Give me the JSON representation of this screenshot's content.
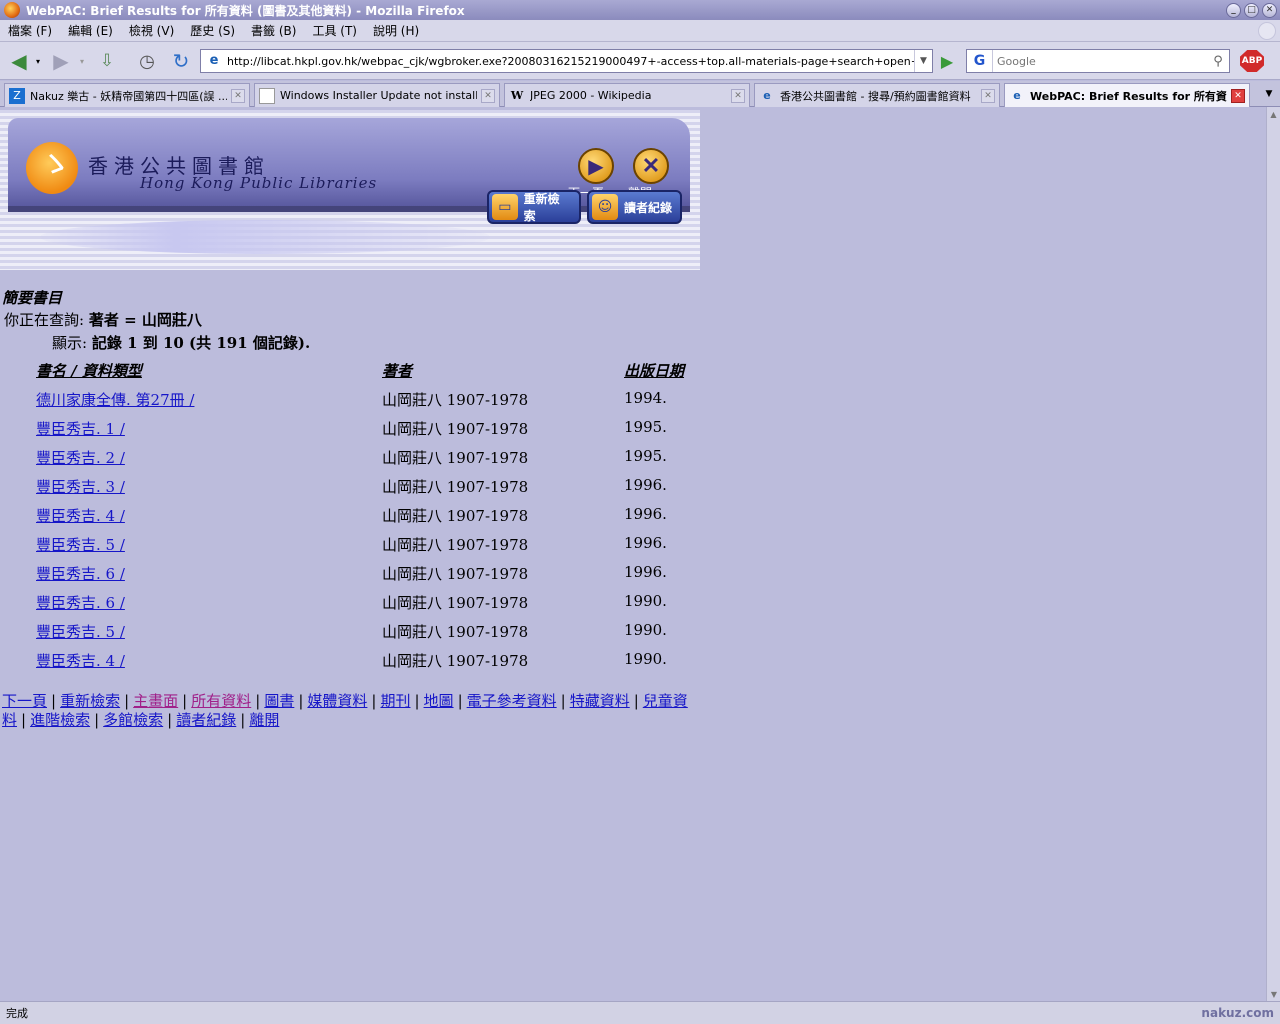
{
  "window": {
    "title": "WebPAC: Brief Results for 所有資料 (圖書及其他資料) - Mozilla Firefox"
  },
  "menu": {
    "items": [
      "檔案 (F)",
      "編輯 (E)",
      "檢視 (V)",
      "歷史 (S)",
      "書籤 (B)",
      "工具 (T)",
      "說明 (H)"
    ]
  },
  "toolbar": {
    "url": "http://libcat.hkpl.gov.hk/webpac_cjk/wgbroker.exe?20080316215219000497+-access+top.all-materials-page+search+open+A+山岡莊八%",
    "search_placeholder": "Google",
    "adblock_label": "ABP"
  },
  "tabs": [
    {
      "label": "Nakuz 樂古 - 妖精帝國第四十四區(誤 ..."
    },
    {
      "label": "Windows Installer Update not installed"
    },
    {
      "label": "JPEG 2000 - Wikipedia"
    },
    {
      "label": "香港公共圖書館 - 搜尋/預約圖書館資料"
    },
    {
      "label": "WebPAC: Brief Results for 所有資..."
    }
  ],
  "banner": {
    "name_zh": "香港公共圖書館",
    "name_en": "Hong Kong Public Libraries",
    "next_label": "下一頁",
    "exit_label": "離開",
    "research_label": "重新檢索",
    "reader_label": "讀者紀錄"
  },
  "page": {
    "title": "簡要書目",
    "query_prefix": "你正在查詢:",
    "query_value": "著者 = 山岡莊八",
    "count_prefix": "顯示:",
    "count_value": "記錄 1 到 10 (共 191 個記錄)."
  },
  "results": {
    "headers": [
      "書名 / 資料類型",
      "著者",
      "出版日期"
    ],
    "rows": [
      {
        "title": "德川家康全傳. 第27冊 /",
        "author": "山岡莊八 1907-1978",
        "date": "1994."
      },
      {
        "title": "豐臣秀吉. 1 /",
        "author": "山岡莊八 1907-1978",
        "date": "1995."
      },
      {
        "title": "豐臣秀吉. 2 /",
        "author": "山岡莊八 1907-1978",
        "date": "1995."
      },
      {
        "title": "豐臣秀吉. 3 /",
        "author": "山岡莊八 1907-1978",
        "date": "1996."
      },
      {
        "title": "豐臣秀吉. 4 /",
        "author": "山岡莊八 1907-1978",
        "date": "1996."
      },
      {
        "title": "豐臣秀吉. 5 /",
        "author": "山岡莊八 1907-1978",
        "date": "1996."
      },
      {
        "title": "豐臣秀吉. 6 /",
        "author": "山岡莊八 1907-1978",
        "date": "1996."
      },
      {
        "title": "豐臣秀吉. 6 /",
        "author": "山岡莊八 1907-1978",
        "date": "1990."
      },
      {
        "title": "豐臣秀吉. 5 /",
        "author": "山岡莊八 1907-1978",
        "date": "1990."
      },
      {
        "title": "豐臣秀吉. 4 /",
        "author": "山岡莊八 1907-1978",
        "date": "1990."
      }
    ]
  },
  "bottom_nav": {
    "next": "下一頁",
    "research": "重新檢索",
    "home": "主畫面",
    "all": "所有資料",
    "books": "圖書",
    "media": "媒體資料",
    "periodicals": "期刊",
    "maps": "地圖",
    "eref": "電子參考資料",
    "special": "特藏資料",
    "children": "兒童資料",
    "advanced": "進階檢索",
    "multi": "多館檢索",
    "reader": "讀者紀錄",
    "exit": "離開"
  },
  "status": {
    "text": "完成",
    "watermark": "nakuz.com"
  },
  "colors": {
    "page_bg": "#bcbcdc",
    "link": "#1616c8",
    "visited_link": "#a0208a"
  }
}
